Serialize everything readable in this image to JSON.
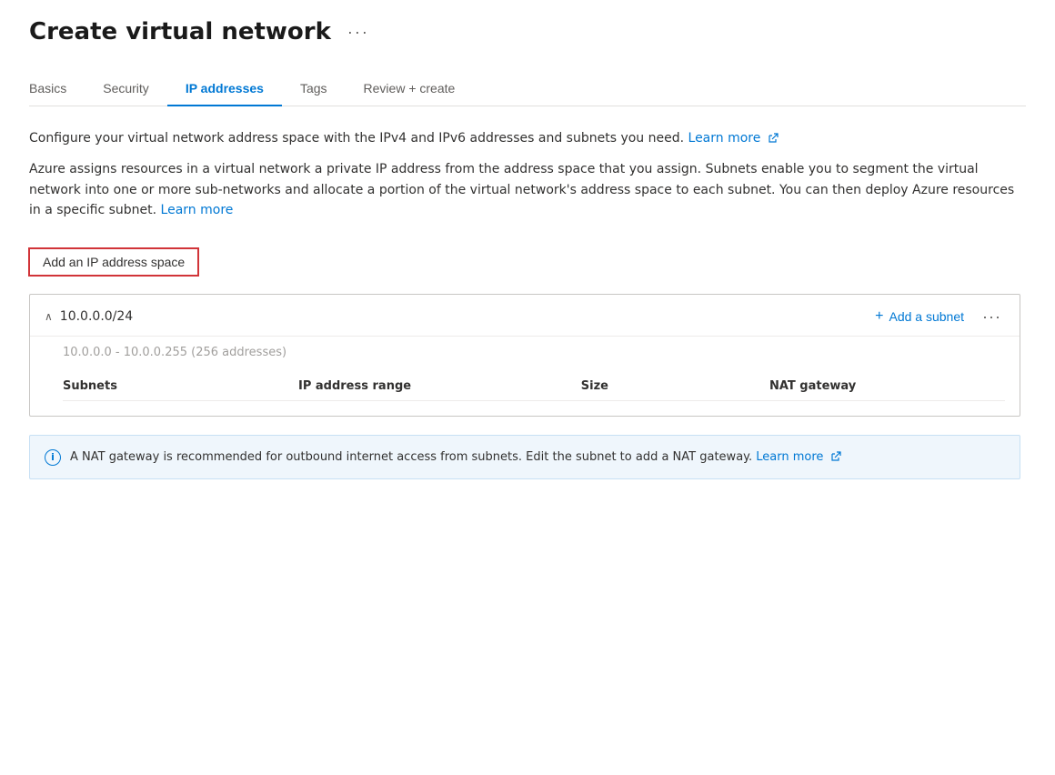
{
  "page": {
    "title": "Create virtual network",
    "ellipsis": "···"
  },
  "tabs": [
    {
      "id": "basics",
      "label": "Basics",
      "active": false
    },
    {
      "id": "security",
      "label": "Security",
      "active": false
    },
    {
      "id": "ip-addresses",
      "label": "IP addresses",
      "active": true
    },
    {
      "id": "tags",
      "label": "Tags",
      "active": false
    },
    {
      "id": "review-create",
      "label": "Review + create",
      "active": false
    }
  ],
  "descriptions": {
    "line1": "Configure your virtual network address space with the IPv4 and IPv6 addresses and subnets you need.",
    "learn_more_1": "Learn more",
    "line2": "Azure assigns resources in a virtual network a private IP address from the address space that you assign. Subnets enable you to segment the virtual network into one or more sub-networks and allocate a portion of the virtual network's address space to each subnet. You can then deploy Azure resources in a specific subnet.",
    "learn_more_2": "Learn more"
  },
  "add_ip_button": "Add an IP address space",
  "ip_space": {
    "cidr": "10.0.0.0/24",
    "range": "10.0.0.0 - 10.0.0.255 (256 addresses)",
    "add_subnet_label": "Add a subnet",
    "more_ellipsis": "···"
  },
  "subnet_table": {
    "columns": [
      "Subnets",
      "IP address range",
      "Size",
      "NAT gateway"
    ]
  },
  "info_banner": {
    "text": "A NAT gateway is recommended for outbound internet access from subnets. Edit the subnet to add a NAT gateway.",
    "learn_more": "Learn more"
  }
}
